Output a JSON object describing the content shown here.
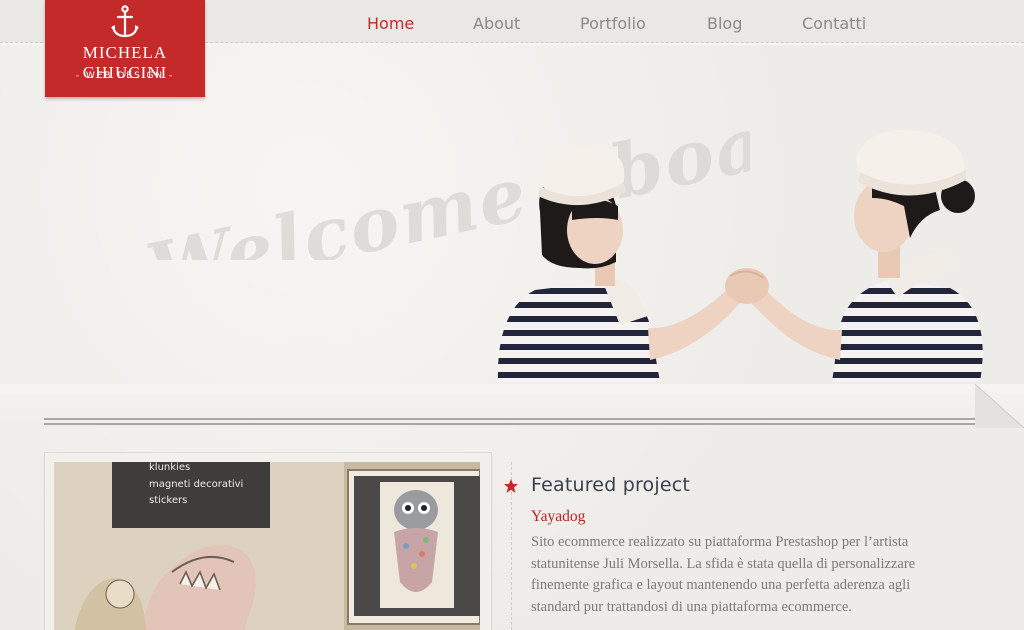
{
  "logo": {
    "name": "MICHELA CHIUCINI",
    "tagline": "WEB DESIGN"
  },
  "nav": {
    "items": [
      {
        "label": "Home",
        "active": true
      },
      {
        "label": "About",
        "active": false
      },
      {
        "label": "Portfolio",
        "active": false
      },
      {
        "label": "Blog",
        "active": false
      },
      {
        "label": "Contatti",
        "active": false
      }
    ]
  },
  "hero": {
    "headline": "Welcome Aboard"
  },
  "featured": {
    "title": "Featured project",
    "project_name": "Yayadog",
    "description": "Sito ecommerce realizzato su piattaforma Prestashop per l’artista statunitense Juli Morsella. La sfida è stata quella di personalizzare finemente grafica e layout mantenendo una perfetta aderenza agli standard pur trattandosi di una piattaforma ecommerce.",
    "thumbnail_menu": [
      "klunkies",
      "magneti decorativi",
      "stickers"
    ]
  },
  "colors": {
    "brand_red": "#c42a2a",
    "nav_inactive": "#8c8a86",
    "title_navy": "#3a3f4e",
    "body_text": "#7c7a76",
    "background": "#eeece8"
  },
  "icons": {
    "logo_mark": "anchor-icon",
    "section_marker": "star-icon"
  }
}
